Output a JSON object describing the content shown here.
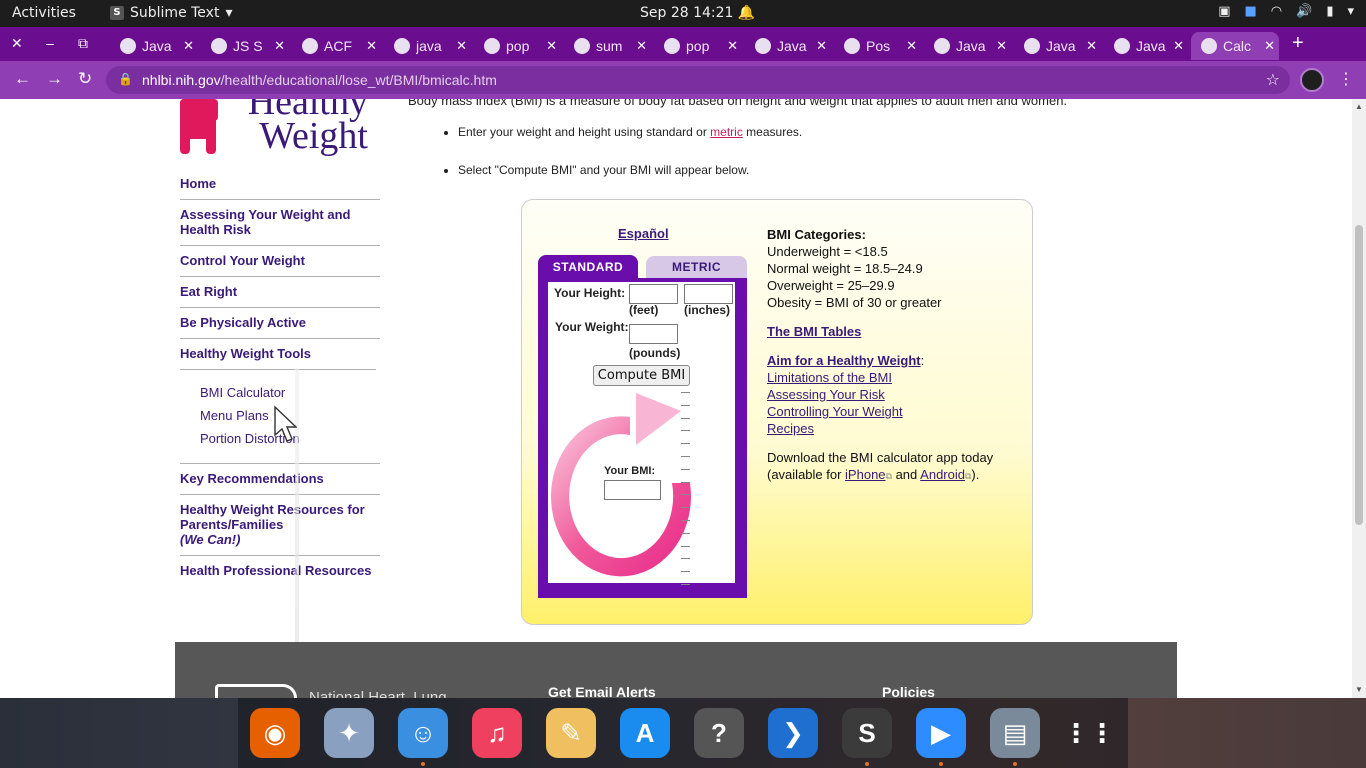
{
  "topbar": {
    "activities": "Activities",
    "app_name": "Sublime Text",
    "clock": "Sep 28  14:21"
  },
  "tabs": [
    {
      "label": "Java",
      "active": false
    },
    {
      "label": "JS S",
      "active": false
    },
    {
      "label": "ACF",
      "active": false
    },
    {
      "label": "java",
      "active": false
    },
    {
      "label": "pop",
      "active": false
    },
    {
      "label": "sum",
      "active": false
    },
    {
      "label": "pop",
      "active": false
    },
    {
      "label": "Java",
      "active": false
    },
    {
      "label": "Pos",
      "active": false
    },
    {
      "label": "Java",
      "active": false
    },
    {
      "label": "Java",
      "active": false
    },
    {
      "label": "Java",
      "active": false
    },
    {
      "label": "Calc",
      "active": true
    }
  ],
  "address": {
    "host": "nhlbi.nih.gov",
    "path": "/health/educational/lose_wt/BMI/bmicalc.htm"
  },
  "logo": {
    "line1": "Healthy",
    "line2": "Weight"
  },
  "sidebar": {
    "links": [
      "Home",
      "Assessing Your Weight and Health Risk",
      "Control Your Weight",
      "Eat Right",
      "Be Physically Active",
      "Healthy Weight Tools"
    ],
    "sub_links": [
      "BMI Calculator",
      "Menu Plans",
      "Portion Distortion"
    ],
    "links_after": [
      "Key Recommendations",
      "Healthy Weight Resources for Parents/Families",
      "Health Professional Resources"
    ],
    "we_can": "(We Can!)"
  },
  "intro": {
    "line": "Body mass index (BMI) is a measure of body fat based on height and weight that applies to adult men and women.",
    "bullet1_pre": "Enter your weight and height using standard or ",
    "bullet1_link": "metric",
    "bullet1_post": " measures.",
    "bullet2": "Select \"Compute BMI\" and your BMI will appear below."
  },
  "calculator": {
    "espanol": "Español",
    "tab_standard": "STANDARD",
    "tab_metric": "METRIC",
    "height_label": "Your Height:",
    "feet_unit": "(feet)",
    "inches_unit": "(inches)",
    "weight_label": "Your Weight:",
    "pounds_unit": "(pounds)",
    "compute_button": "Compute BMI",
    "bmi_label": "Your BMI:"
  },
  "categories": {
    "title": "BMI Categories:",
    "items": [
      "Underweight = <18.5",
      "Normal weight = 18.5–24.9",
      "Overweight = 25–29.9",
      "Obesity = BMI of 30 or greater"
    ],
    "bmi_tables": "The BMI Tables",
    "aim_link": "Aim for a Healthy Weight",
    "aim_colon": ":",
    "aim_items": [
      "Limitations of the BMI",
      "Assessing Your Risk",
      "Controlling Your Weight",
      "Recipes"
    ],
    "app_line1": "Download the BMI calculator app today",
    "app_pre": "(available for ",
    "iphone": "iPhone",
    "and": " and ",
    "android": "Android",
    "app_post": ")."
  },
  "footer": {
    "org": "National Heart, Lung",
    "email_alerts": "Get Email Alerts",
    "policies": "Policies"
  },
  "colors": {
    "chrome_purple": "#6a0d8f",
    "link_purple": "#3a1a78",
    "metric_link": "#c41c5a",
    "calc_purple": "#6a0dad"
  },
  "dock": [
    "firefox-icon",
    "mail-eagle-icon",
    "finder-icon",
    "music-icon",
    "text-editor-icon",
    "app-store-icon",
    "help-icon",
    "vscode-icon",
    "sublime-icon",
    "zoom-icon",
    "image-viewer-icon",
    "app-grid-icon"
  ]
}
